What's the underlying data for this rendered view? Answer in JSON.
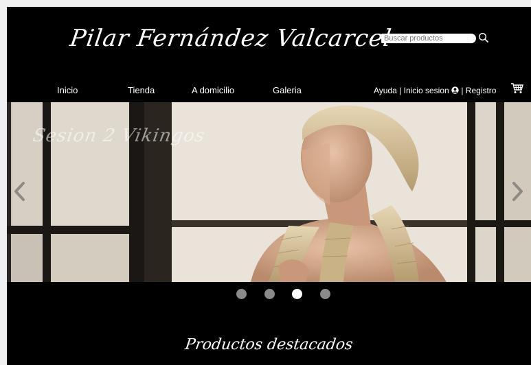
{
  "header": {
    "brand": "Pilar Fernández Valcarcel",
    "search_placeholder": "Buscar productos",
    "search_icon": "magnifier-icon",
    "cart_icon": "shopping-cart-icon"
  },
  "nav": {
    "items": [
      {
        "label": "Inicio"
      },
      {
        "label": "Tienda"
      },
      {
        "label": "A domicilio"
      },
      {
        "label": "Galeria"
      }
    ],
    "account": {
      "help": "Ayuda",
      "sep1": " | ",
      "login": "Inicio sesion",
      "user_icon": "user-circle-icon",
      "sep2": " | ",
      "register": "Registro"
    }
  },
  "slider": {
    "caption": "Sesion 2 Vikingos",
    "prev_icon": "chevron-left-icon",
    "next_icon": "chevron-right-icon",
    "slide_count": 4,
    "active_index": 2
  },
  "featured": {
    "title": "Productos destacados"
  },
  "colors": {
    "background": "#000000",
    "text": "#ffffff",
    "dot_inactive": "#8a8a8a",
    "dot_active": "#ffffff"
  }
}
